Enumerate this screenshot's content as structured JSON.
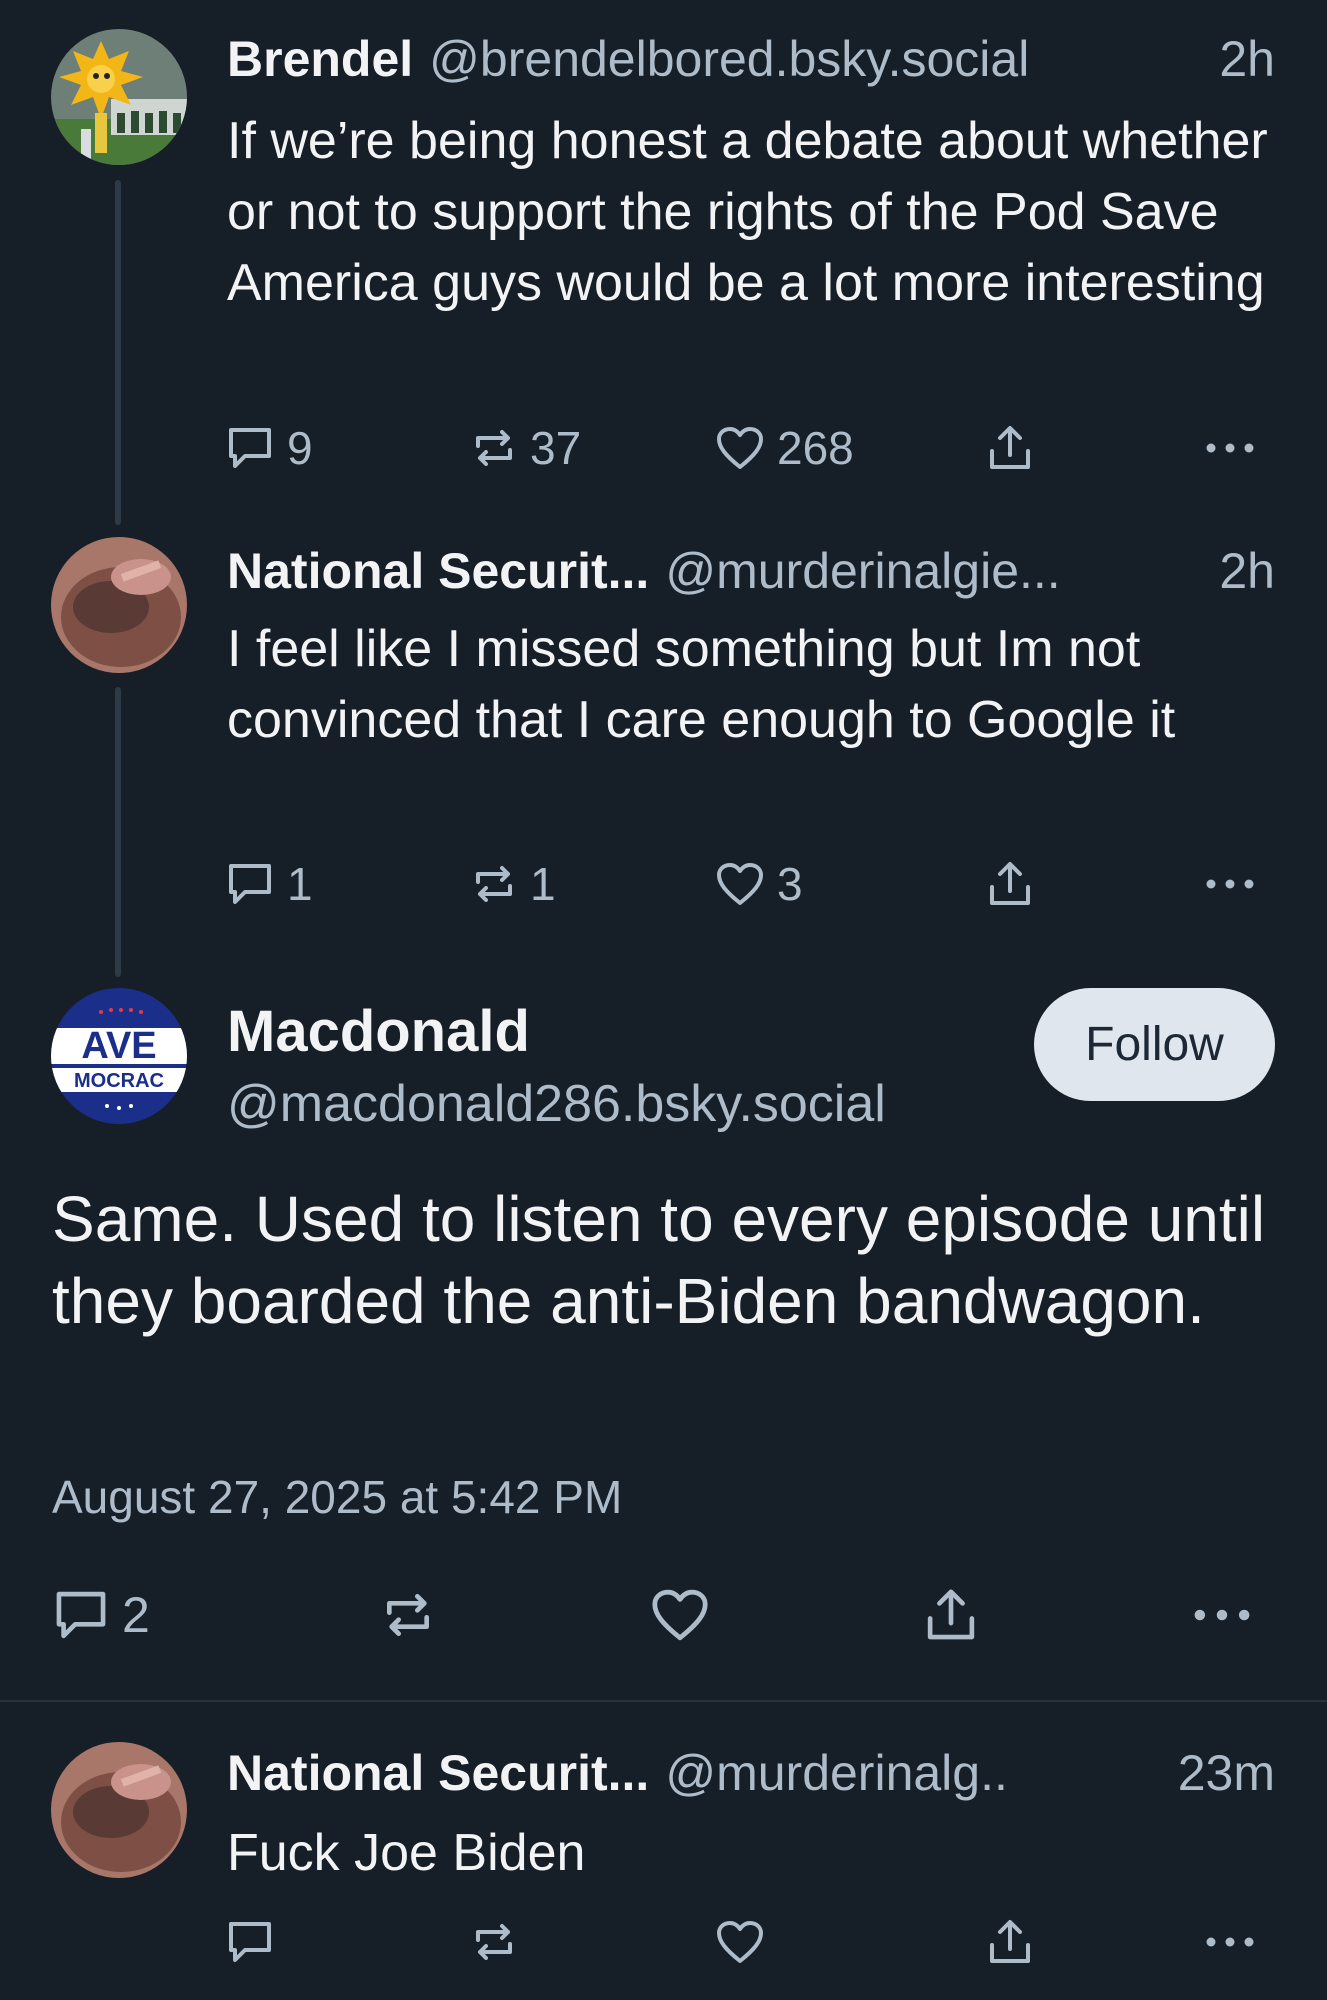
{
  "posts": [
    {
      "name": "Brendel",
      "handle": "@brendelbored.bsky.social",
      "time": "2h",
      "text": "If we’re being honest a debate about whether or not to support the rights of the Pod Save America guys would be a lot more interesting",
      "replies": "9",
      "reposts": "37",
      "likes": "268"
    },
    {
      "name": "National Securit...",
      "handle": "@murderinalgie...",
      "time": "2h",
      "text": "I feel like I missed something but Im not convinced that I care enough to Google it",
      "replies": "1",
      "reposts": "1",
      "likes": "3"
    }
  ],
  "main_post": {
    "name": "Macdonald",
    "handle": "@macdonald286.bsky.social",
    "follow_label": "Follow",
    "text": "Same. Used to listen to every episode until they boarded the anti-Biden bandwagon.",
    "date": "August 27, 2025 at 5:42 PM",
    "replies": "2",
    "avatar_text_top": "AVE",
    "avatar_text_bottom": "MOCRAC"
  },
  "reply_post": {
    "name": "National Securit...",
    "handle": "@murderinalg..",
    "time": "23m",
    "text": "Fuck Joe Biden"
  },
  "icons": [
    "reply-icon",
    "repost-icon",
    "like-icon",
    "share-icon",
    "more-icon"
  ],
  "colors": {
    "background": "#161e27",
    "text": "#f1f3f5",
    "muted": "#aebbc9",
    "follow_bg": "#dfe6ee"
  }
}
